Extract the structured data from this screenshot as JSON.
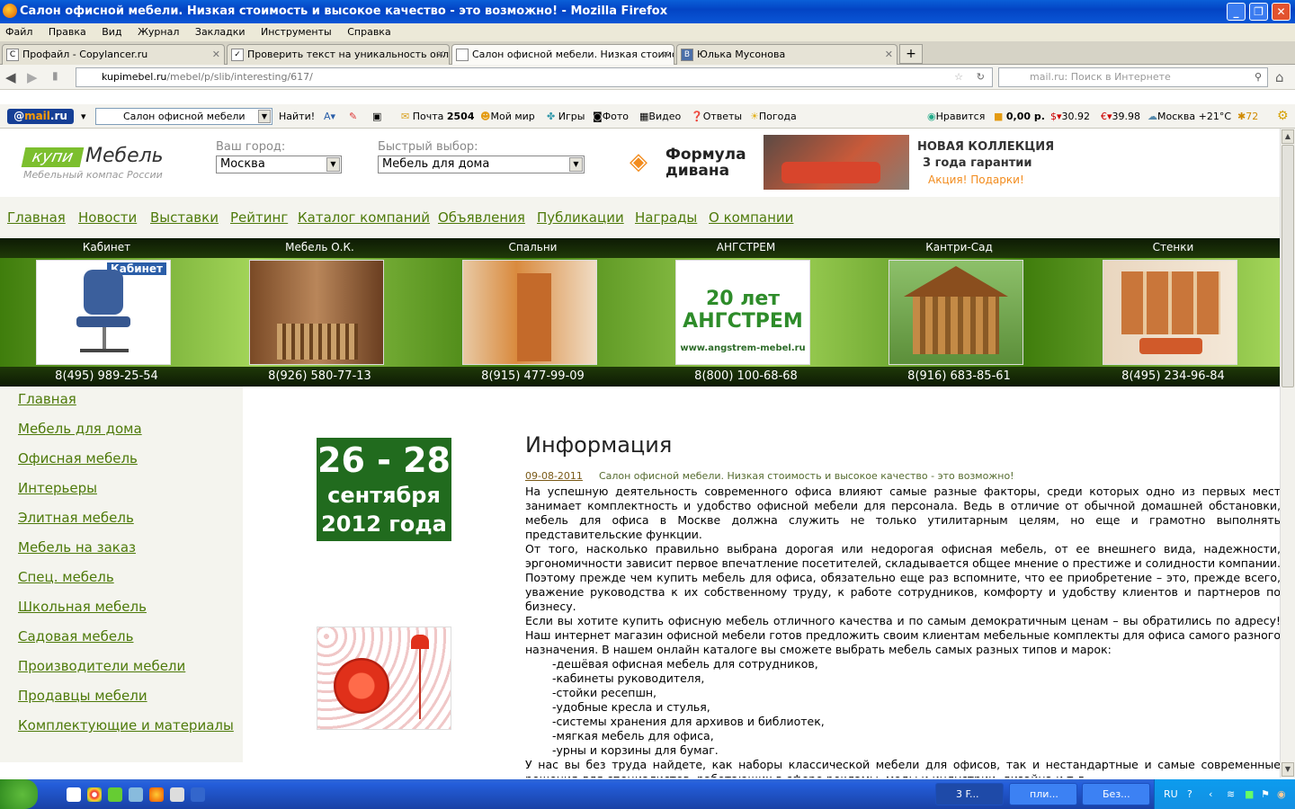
{
  "window": {
    "title": "Салон офисной мебели. Низкая стоимость и высокое качество - это возможно! - Mozilla Firefox"
  },
  "menu": [
    "Файл",
    "Правка",
    "Вид",
    "Журнал",
    "Закладки",
    "Инструменты",
    "Справка"
  ],
  "tabs": [
    {
      "title": "Профайл - Copylancer.ru",
      "icon": "C"
    },
    {
      "title": "Проверить текст на уникальность онл...",
      "icon": "✓"
    },
    {
      "title": "Салон офисной мебели. Низкая стоимо...",
      "icon": ""
    },
    {
      "title": "Юлька Мусонова",
      "icon": "B"
    }
  ],
  "nav": {
    "url_domain": "kupimebel.ru",
    "url_path": "/mebel/p/slib/interesting/617/",
    "search_placeholder": "mail.ru: Поиск в Интернете"
  },
  "mailbar": {
    "logo_prefix": "@",
    "logo_brand": "mail",
    "logo_suffix": ".ru",
    "search_value": "Салон офисной мебели",
    "find_label": "Найти!",
    "mail_label": "Почта",
    "mail_count": "2504",
    "my_world": "Мой мир",
    "games": "Игры",
    "photo": "Фото",
    "video": "Видео",
    "answers": "Ответы",
    "weather": "Погода",
    "likes": "Нравится",
    "balance": "0,00 р.",
    "usd": "30.92",
    "eur": "39.98",
    "city_weather": "Москва +21°C",
    "count": "72"
  },
  "site": {
    "logo_kupi": "купи",
    "logo_mebel": "Мебель",
    "logo_tagline": "Мебельный компас России",
    "city_label": "Ваш город:",
    "city_value": "Москва",
    "quick_label": "Быстрый выбор:",
    "quick_value": "Мебель для дома",
    "formula_line1": "Формула",
    "formula_line2": "дивана",
    "banner_line1": "НОВАЯ КОЛЛЕКЦИЯ",
    "banner_line2": "3 года гарантии",
    "banner_line3": "Акция! Подарки!",
    "nav": [
      "Главная",
      "Новости",
      "Выставки",
      "Рейтинг",
      "Каталог компаний",
      "Объявления",
      "Публикации",
      "Награды",
      "О компании"
    ],
    "showcase": [
      {
        "name": "Кабинет",
        "phone": "8(495) 989-25-54",
        "img_text": "Кабинет",
        "color": "#ffffff"
      },
      {
        "name": "Мебель О.К.",
        "phone": "8(926) 580-77-13",
        "img_text": "",
        "color": "#8a5a34"
      },
      {
        "name": "Спальни",
        "phone": "8(915) 477-99-09",
        "img_text": "",
        "color": "#c9874a"
      },
      {
        "name": "АНГСТРЕМ",
        "phone": "8(800) 100-68-68",
        "img_text": "20 лет АНГСТРЕМ",
        "img_url": "www.angstrem-mebel.ru",
        "color": "#ffffff"
      },
      {
        "name": "Кантри-Сад",
        "phone": "8(916) 683-85-61",
        "img_text": "",
        "color": "#a5702e"
      },
      {
        "name": "Стенки",
        "phone": "8(495) 234-96-84",
        "img_text": "",
        "color": "#b86a34"
      }
    ],
    "sidebar": [
      "Главная",
      "Мебель для дома",
      "Офисная мебель",
      "Интерьеры",
      "Элитная мебель",
      "Мебель на заказ",
      "Спец. мебель",
      "Школьная мебель",
      "Садовая мебель",
      "Производители мебели",
      "Продавцы мебели",
      "Комплектующие и материалы"
    ],
    "datebox": {
      "line1": "26 - 28",
      "line2": "сентября",
      "line3": "2012 года"
    },
    "article": {
      "heading": "Информация",
      "date": "09-08-2011",
      "title": "Салон офисной мебели. Низкая стоимость и высокое качество - это возможно!",
      "p1": "На успешную деятельность современного офиса влияют самые разные факторы, среди которых одно из первых мест занимает комплектность и удобство офисной мебели для персонала. Ведь в отличие от обычной домашней обстановки, мебель для офиса в Москве должна служить не только утилитарным целям, но еще и грамотно выполнять представительские функции.",
      "p2": "От того, насколько правильно выбрана дорогая или недорогая офисная мебель, от ее внешнего вида, надежности, эргономичности зависит первое впечатление посетителей, складывается общее мнение о престиже и солидности компании. Поэтому прежде чем купить мебель для офиса, обязательно еще раз вспомните, что ее приобретение – это, прежде всего, уважение руководства к их собственному труду, к работе сотрудников, комфорту и удобству клиентов и партнеров по бизнесу.",
      "p3": "Если вы хотите купить офисную мебель отличного качества и по самым демократичным ценам – вы обратились по адресу! Наш интернет магазин офисной мебели готов предложить своим клиентам мебельные комплекты для офиса самого разного назначения. В нашем онлайн каталоге вы сможете выбрать мебель самых разных типов и марок:",
      "list": [
        "-дешёвая офисная мебель для сотрудников,",
        "-кабинеты руководителя,",
        "-стойки ресепшн,",
        "-удобные кресла и стулья,",
        "-системы хранения для архивов и библиотек,",
        "-мягкая мебель для офиса,",
        "-урны и корзины для бумаг."
      ],
      "p4": "У нас вы без труда найдете, как наборы классической мебели для офисов, так и нестандартные и самые современные решения для специалистов, работающих в сфере рекламы, моды и индустрии, дизайна и т.д."
    }
  },
  "taskbar": {
    "items": [
      "3 F...",
      "пли...",
      "Без..."
    ],
    "lang": "RU"
  }
}
